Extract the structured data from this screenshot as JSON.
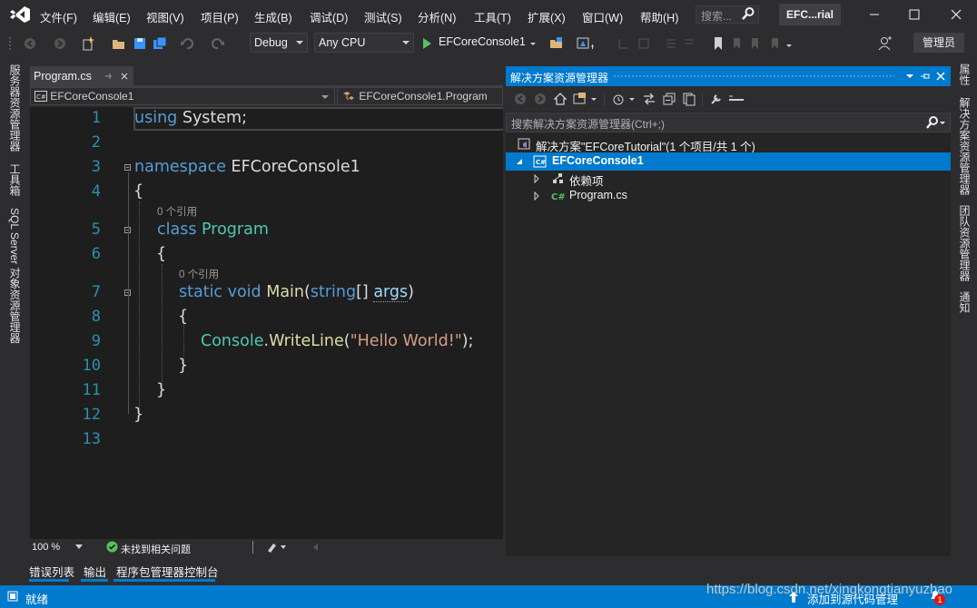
{
  "menu": {
    "items": [
      "文件(F)",
      "编辑(E)",
      "视图(V)",
      "项目(P)",
      "生成(B)",
      "调试(D)",
      "测试(S)",
      "分析(N)",
      "工具(T)",
      "扩展(X)",
      "窗口(W)",
      "帮助(H)"
    ],
    "search_placeholder": "搜索...",
    "solution_title": "EFC...rial"
  },
  "toolbar": {
    "config": "Debug",
    "platform": "Any CPU",
    "start_label": "EFCoreConsole1",
    "admin_label": "管理员"
  },
  "left_strip": {
    "tabs": [
      "服务器资源管理器",
      "工具箱",
      "SQL Server 对象资源管理器"
    ]
  },
  "right_strip": {
    "tabs": [
      "属性",
      "解决方案资源管理器",
      "团队资源管理器",
      "通知"
    ]
  },
  "editor": {
    "tab_label": "Program.cs",
    "nav_project": "EFCoreConsole1",
    "nav_class": "EFCoreConsole1.Program",
    "line_numbers": [
      "1",
      "2",
      "3",
      "4",
      "5",
      "6",
      "7",
      "8",
      "9",
      "10",
      "11",
      "12",
      "13"
    ],
    "ref_hint": "0 个引用",
    "code": {
      "l1_kw": "using",
      "l1_rest": " System;",
      "l3_kw": "namespace",
      "l3_rest": " EFCoreConsole1",
      "l4": "{",
      "l5_kw": "class",
      "l5_type": "Program",
      "l6": "{",
      "l7_kw": "static void",
      "l7_fn": "Main",
      "l7_open": "(",
      "l7_type": "string",
      "l7_arr": "[] ",
      "l7_param": "args",
      "l7_close": ")",
      "l8": "{",
      "l9_type": "Console",
      "l9_dot": ".",
      "l9_fn": "WriteLine",
      "l9_open": "(",
      "l9_str": "\"Hello World!\"",
      "l9_close": ");",
      "l10": "}",
      "l11": "}",
      "l12": "}"
    },
    "zoom": "100 %",
    "issues": "未找到相关问题"
  },
  "solution_explorer": {
    "title": "解决方案资源管理器",
    "search_placeholder": "搜索解决方案资源管理器(Ctrl+;)",
    "solution_node": "解决方案\"EFCoreTutorial\"(1 个项目/共 1 个)",
    "project_node": "EFCoreConsole1",
    "deps_node": "依赖项",
    "file_node": "Program.cs"
  },
  "bottom_tabs": [
    "错误列表",
    "输出",
    "程序包管理器控制台"
  ],
  "status": {
    "ready": "就绪",
    "source_control": "添加到源代码管理",
    "notifications": "1",
    "watermark": "https://blog.csdn.net/xingkongtianyuzhao"
  },
  "colors": {
    "accent": "#007acc",
    "editor_bg": "#1e1e1e",
    "keyword": "#569cd6",
    "type": "#4ec9b0",
    "function": "#dcdcaa",
    "string": "#d69d85",
    "line_number": "#2b91af"
  }
}
